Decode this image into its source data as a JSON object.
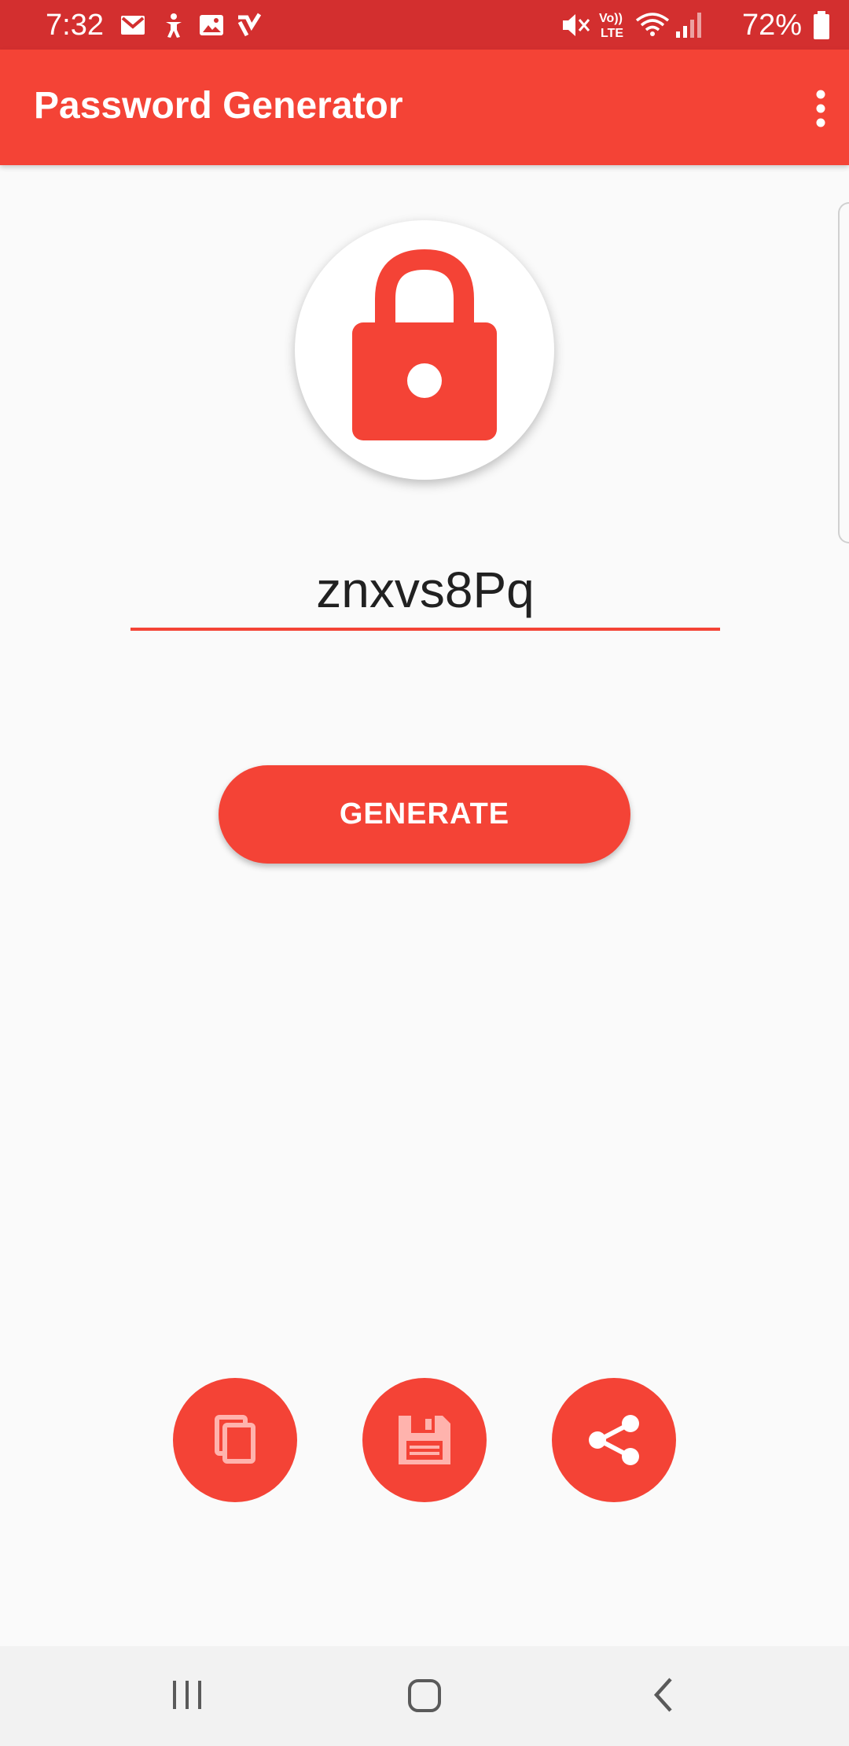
{
  "status_bar": {
    "time": "7:32",
    "battery": "72%",
    "icons": [
      "gmail-icon",
      "accessibility-icon",
      "gallery-icon",
      "task-icon",
      "mute-icon",
      "volte-icon",
      "wifi-icon",
      "signal-icon",
      "battery-icon"
    ]
  },
  "app_bar": {
    "title": "Password Generator",
    "menu_icon": "more-vert-icon"
  },
  "main": {
    "header_icon": "lock-icon",
    "password": "znxvs8Pq",
    "generate_label": "GENERATE"
  },
  "actions": [
    {
      "icon": "copy-icon"
    },
    {
      "icon": "save-icon"
    },
    {
      "icon": "share-icon"
    }
  ],
  "nav_bar": {
    "icons": [
      "recents-icon",
      "home-icon",
      "back-icon"
    ]
  },
  "colors": {
    "primary": "#f44336",
    "primary_dark": "#d32f2f",
    "background": "#fafafa"
  }
}
